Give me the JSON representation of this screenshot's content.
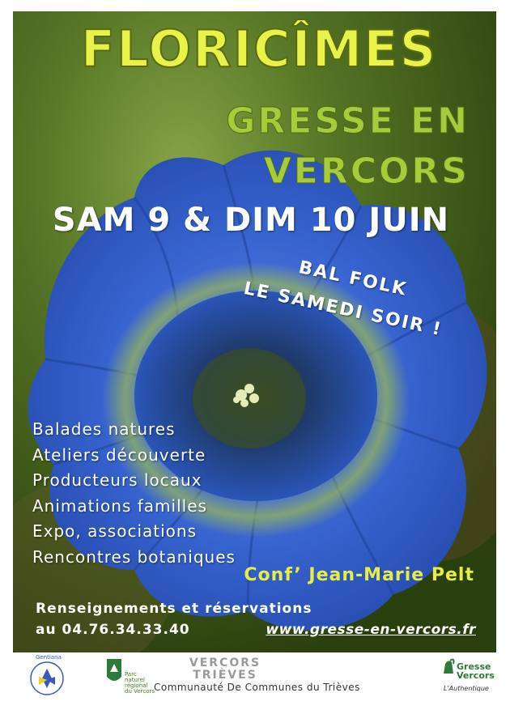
{
  "poster": {
    "title": "FLORICÎMES",
    "subtitle_line1": "GRESSE EN",
    "subtitle_line2": "VERCORS",
    "dates": "SAM 9 & DIM 10 JUIN",
    "bal_line1": "BAL FOLK",
    "bal_line2": "LE SAMEDI SOIR !",
    "activities": [
      "Balades natures",
      "Ateliers découverte",
      "Producteurs locaux",
      "Animations familles",
      "Expo, associations",
      "Rencontres botaniques"
    ],
    "conference": "Conf’ Jean-Marie Pelt",
    "info_line1": "Renseignements et réservations",
    "info_line2": "au 04.76.34.33.40",
    "website": "www.gresse-en-vercors.fr"
  },
  "footer": {
    "logo_gentiana": "Gentiana",
    "logo_parc_line1": "Parc",
    "logo_parc_line2": "naturel",
    "logo_parc_line3": "régional",
    "logo_parc_line4": "du Vercors",
    "logo_vt_line1": "VERCORS",
    "logo_vt_line2": "TRIÈVES",
    "community": "Communauté De Communes du Trièves",
    "logo_gresse_line1": "Gresse",
    "logo_gresse_line2": "Vercors",
    "logo_gresse_tagline": "L'Authentique"
  },
  "colors": {
    "title": "#e8f24a",
    "subtitle": "#a6cc3c",
    "flower": "#2f58c8",
    "background": "#3d5a17"
  }
}
